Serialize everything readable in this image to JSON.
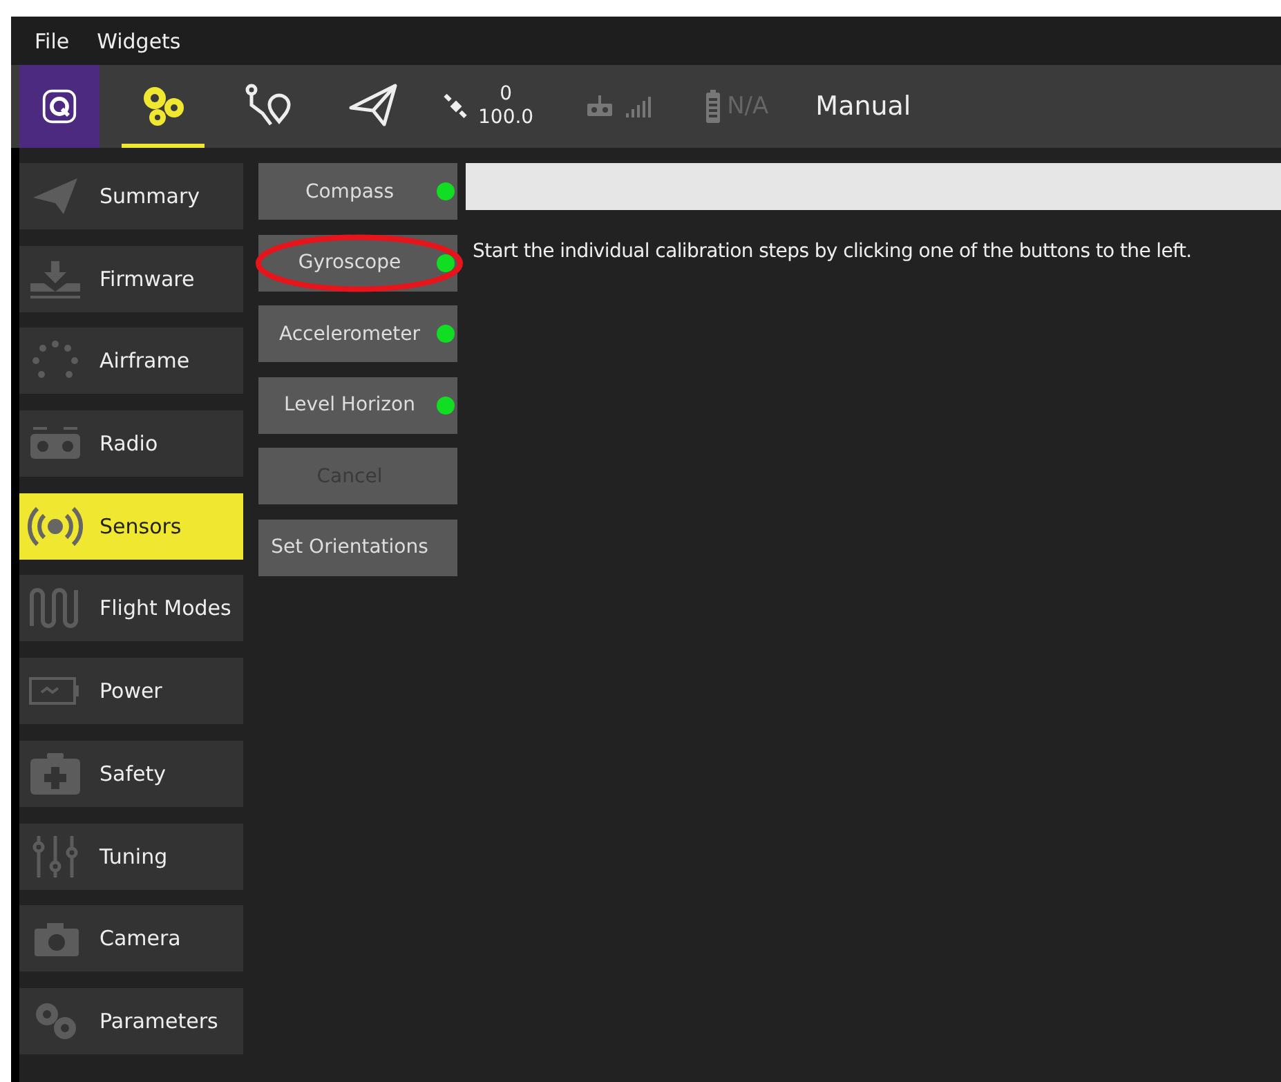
{
  "menu": [
    "File",
    "Widgets"
  ],
  "toolbar": {
    "tools": [
      {
        "selected": true
      },
      {
        "selected": false
      },
      {
        "selected": false
      }
    ],
    "gps_count": "0",
    "gps_hdop": "100.0",
    "battery": "N/A",
    "flight_mode": "Manual"
  },
  "sidebar": {
    "items": [
      {
        "label": "Summary",
        "selected": false
      },
      {
        "label": "Firmware",
        "selected": false
      },
      {
        "label": "Airframe",
        "selected": false
      },
      {
        "label": "Radio",
        "selected": false
      },
      {
        "label": "Sensors",
        "selected": true
      },
      {
        "label": "Flight Modes",
        "selected": false
      },
      {
        "label": "Power",
        "selected": false
      },
      {
        "label": "Safety",
        "selected": false
      },
      {
        "label": "Tuning",
        "selected": false
      },
      {
        "label": "Camera",
        "selected": false
      },
      {
        "label": "Parameters",
        "selected": false
      }
    ]
  },
  "calibration_buttons": [
    {
      "label": "Compass",
      "color": "#11dd22",
      "disabled": false,
      "circled": false
    },
    {
      "label": "Gyroscope",
      "color": "#11dd22",
      "disabled": false,
      "circled": true
    },
    {
      "label": "Accelerometer",
      "color": "#11dd22",
      "disabled": false,
      "circled": false
    },
    {
      "label": "Level Horizon",
      "color": "#11dd22",
      "disabled": false,
      "circled": false
    },
    {
      "label": "Cancel",
      "disabled": true,
      "circled": false
    },
    {
      "label": "Set Orientations",
      "disabled": false,
      "circled": false
    }
  ],
  "instructions": "Start the individual calibration steps by clicking one of the buttons to the left."
}
